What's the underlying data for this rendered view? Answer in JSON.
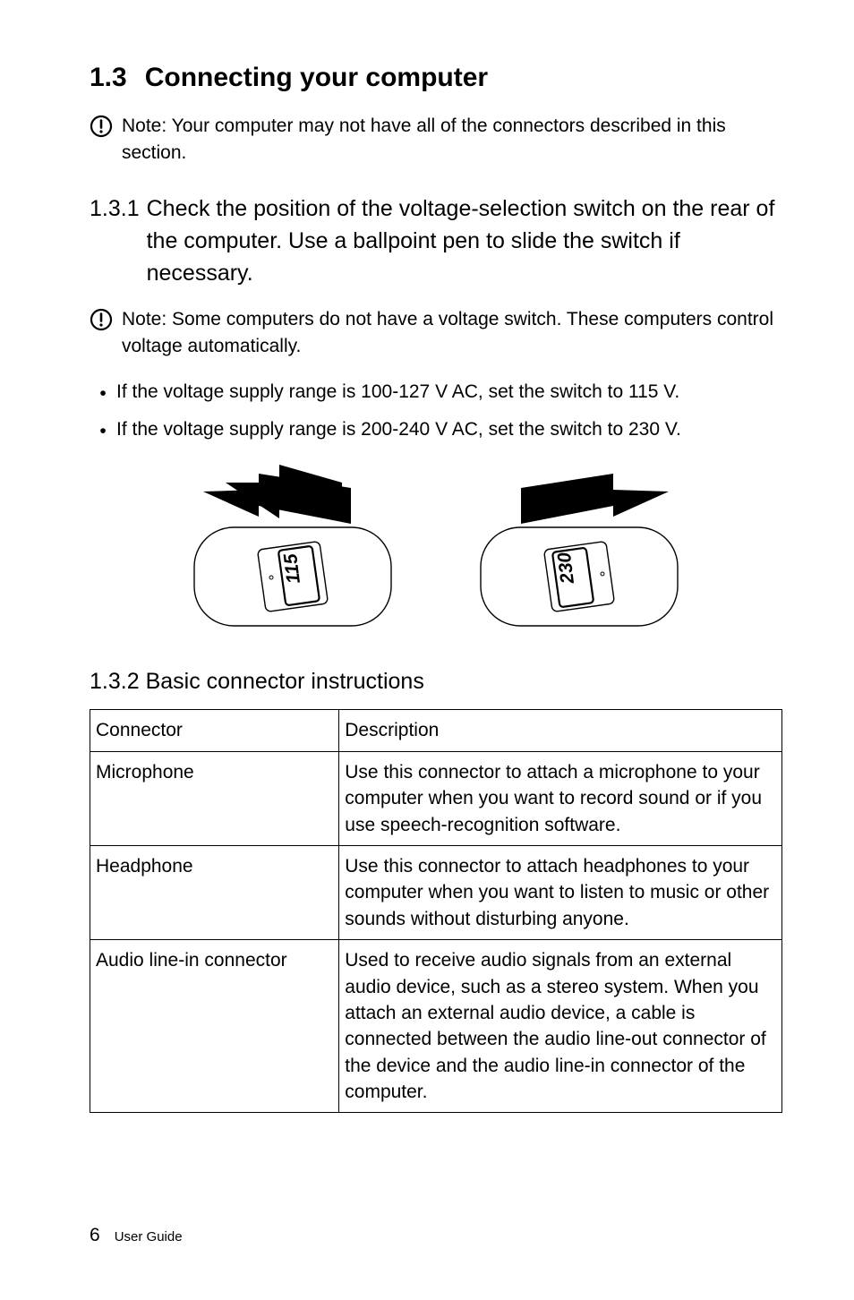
{
  "heading": {
    "number": "1.3",
    "title": "Connecting your computer"
  },
  "note1": {
    "label": "Note:",
    "text": "Your computer may not have all of the connectors described in this section."
  },
  "sub1": {
    "number": "1.3.1",
    "title": "Check the position of the voltage-selection switch on the rear of the computer. Use a ballpoint pen to slide the switch if necessary."
  },
  "note2": {
    "label": "Note:",
    "text": "Some computers do not have a voltage switch. These computers control voltage automatically."
  },
  "bullets": [
    "If the voltage supply range is 100-127 V AC, set the switch to 115 V.",
    "If the voltage supply range is 200-240 V AC, set the switch to 230 V."
  ],
  "figure_labels": {
    "left": "115",
    "right": "230"
  },
  "sub2": {
    "number": "1.3.2",
    "title": "Basic connector instructions"
  },
  "table": {
    "headers": [
      "Connector",
      "Description"
    ],
    "rows": [
      [
        "Microphone",
        "Use this connector to attach a microphone to your computer when you want to record sound or if you use speech-recognition software."
      ],
      [
        "Headphone",
        "Use this connector to attach headphones to your computer when you want to listen to music or other sounds without disturbing anyone."
      ],
      [
        "Audio line-in connector",
        "Used to receive audio signals from an external audio device, such as a stereo system. When you attach an external audio device, a cable is connected between the audio line-out connector of the device and the audio line-in connector of the computer."
      ]
    ]
  },
  "footer": {
    "page": "6",
    "label": "User Guide"
  }
}
